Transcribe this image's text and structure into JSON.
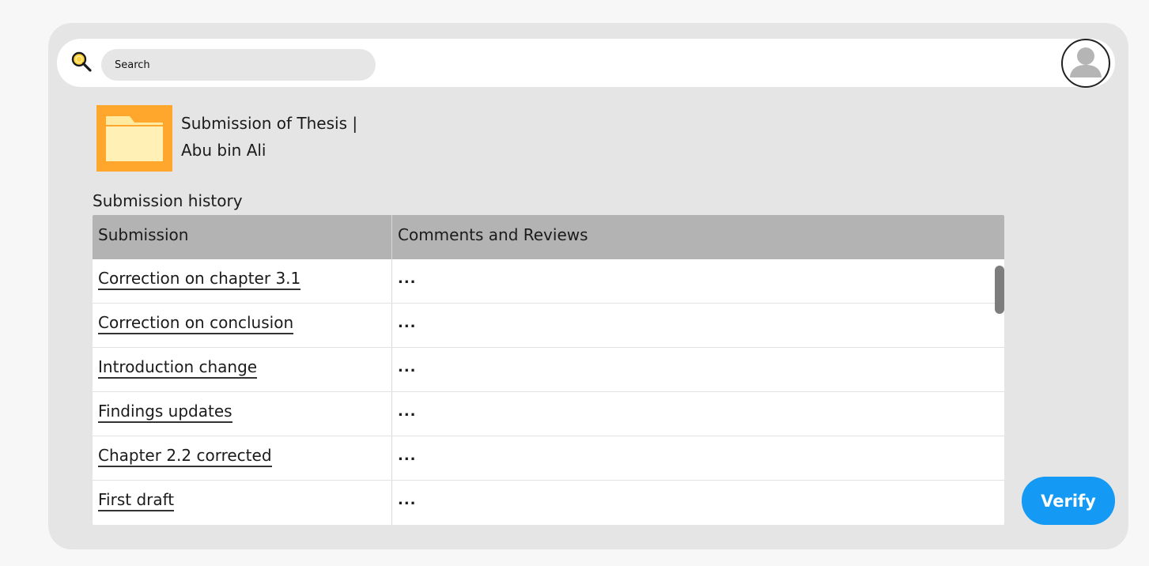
{
  "search": {
    "placeholder": "Search",
    "icon": "search-icon"
  },
  "header": {
    "avatar_icon": "user-avatar-icon"
  },
  "document": {
    "icon": "folder-icon",
    "icon_color": "#ffa72c",
    "title_line1": "Submission of Thesis |",
    "title_line2": "Abu bin Ali"
  },
  "history": {
    "label": "Submission history",
    "columns": [
      "Submission",
      "Comments and Reviews"
    ],
    "rows": [
      {
        "submission": "Correction on chapter 3.1",
        "comment": "..."
      },
      {
        "submission": "Correction on conclusion",
        "comment": "..."
      },
      {
        "submission": "Introduction change",
        "comment": "..."
      },
      {
        "submission": "Findings updates",
        "comment": "..."
      },
      {
        "submission": "Chapter 2.2 corrected",
        "comment": "..."
      },
      {
        "submission": "First draft",
        "comment": "..."
      }
    ]
  },
  "actions": {
    "verify_label": "Verify",
    "verify_color": "#1499f5"
  }
}
